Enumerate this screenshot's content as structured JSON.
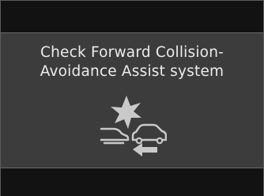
{
  "warning": {
    "line1": "Check Forward Collision-",
    "line2": "Avoidance Assist system",
    "icon": "forward-collision-warning-icon"
  },
  "colors": {
    "background": "#3c3c3c",
    "bar": "#121212",
    "text": "#ececec",
    "icon": "#c9c9c9"
  }
}
